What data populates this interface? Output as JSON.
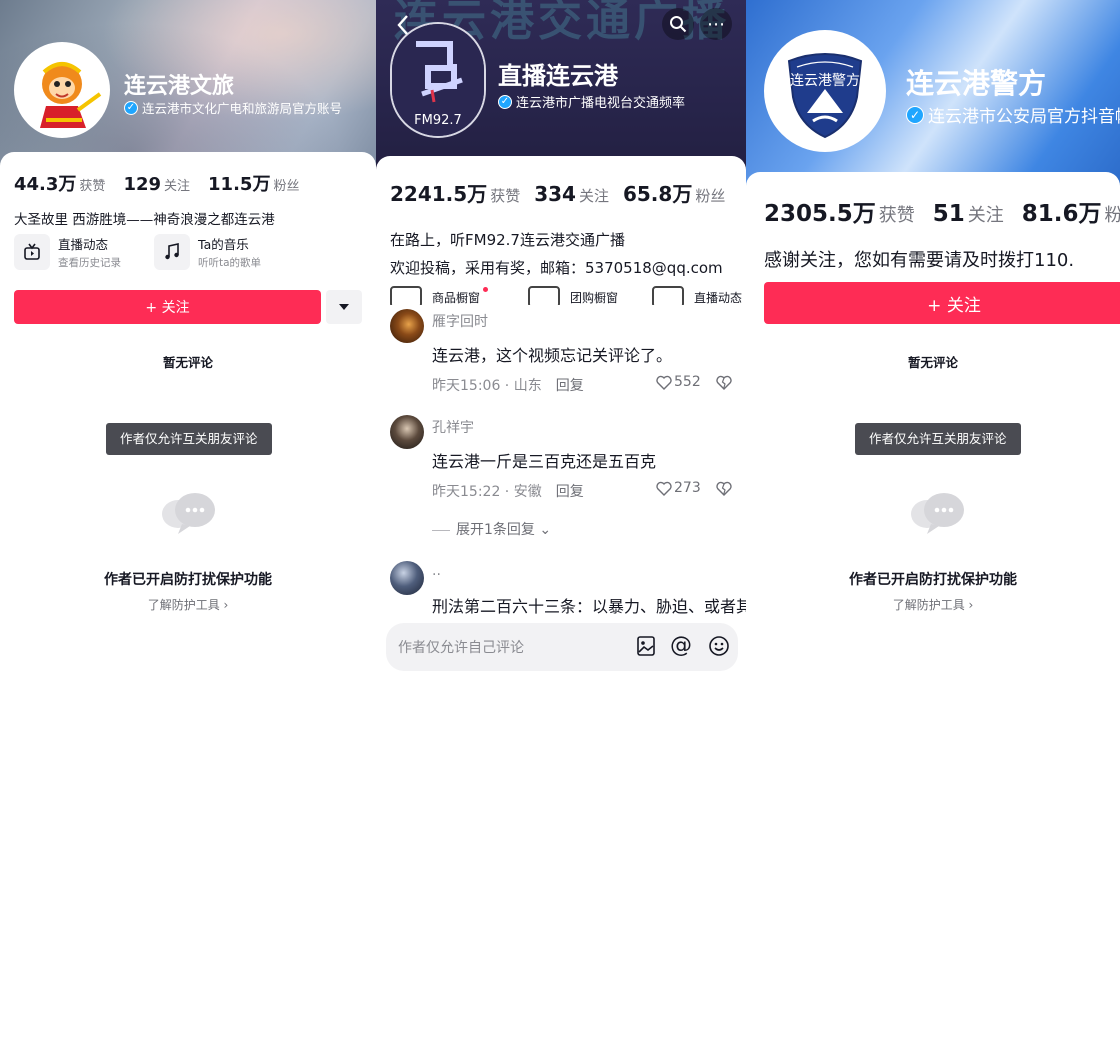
{
  "panel1": {
    "name": "连云港文旅",
    "verify": "连云港市文化广电和旅游局官方账号",
    "stats": [
      {
        "num": "44.3万",
        "label": "获赞"
      },
      {
        "num": "129",
        "label": "关注"
      },
      {
        "num": "11.5万",
        "label": "粉丝"
      }
    ],
    "bio": "大圣故里 西游胜境——神奇浪漫之都连云港",
    "tiles": [
      {
        "title": "直播动态",
        "sub": "查看历史记录"
      },
      {
        "title": "Ta的音乐",
        "sub": "听听ta的歌单"
      }
    ],
    "follow": "+ 关注",
    "no_comment": "暂无评论",
    "pill": "作者仅允许互关朋友评论",
    "protect": "作者已开启防打扰保护功能",
    "learn": "了解防护工具 ›"
  },
  "panel2": {
    "banner": "连云港交通广播",
    "logo_text": "FM92.7",
    "name": "直播连云港",
    "verify": "连云港市广播电视台交通频率",
    "stats": [
      {
        "num": "2241.5万",
        "label": "获赞"
      },
      {
        "num": "334",
        "label": "关注"
      },
      {
        "num": "65.8万",
        "label": "粉丝"
      }
    ],
    "bio_line1": "在路上，听FM92.7连云港交通广播",
    "bio_line2": "欢迎投稿，采用有奖，邮箱：5370518@qq.com",
    "shops": [
      "商品橱窗",
      "团购橱窗",
      "直播动态"
    ],
    "comments": [
      {
        "user": "雁字回时",
        "text": "连云港，这个视频忘记关评论了。",
        "meta": "昨天15:06 · 山东",
        "reply": "回复",
        "likes": "552"
      },
      {
        "user": "孔祥宇",
        "text": "连云港一斤是三百克还是五百克",
        "meta": "昨天15:22 · 安徽",
        "reply": "回复",
        "likes": "273",
        "expand": "展开1条回复"
      },
      {
        "user": "..",
        "text": "刑法第二百六十三条：以暴力、胁迫、或者其"
      }
    ],
    "input_placeholder": "作者仅允许自己评论"
  },
  "panel3": {
    "name": "连云港警方",
    "badge_text": "连云港警方",
    "verify": "连云港市公安局官方抖音帐号",
    "stats": [
      {
        "num": "2305.5万",
        "label": "获赞"
      },
      {
        "num": "51",
        "label": "关注"
      },
      {
        "num": "81.6万",
        "label": "粉丝"
      }
    ],
    "bio": "感谢关注，您如有需要请及时拨打110.",
    "follow": "+ 关注",
    "no_comment": "暂无评论",
    "pill": "作者仅允许互关朋友评论",
    "protect": "作者已开启防打扰保护功能",
    "learn": "了解防护工具 ›"
  },
  "colors": {
    "accent": "#fe2c55",
    "verify": "#20a6ff",
    "pill": "#4a4b52"
  }
}
